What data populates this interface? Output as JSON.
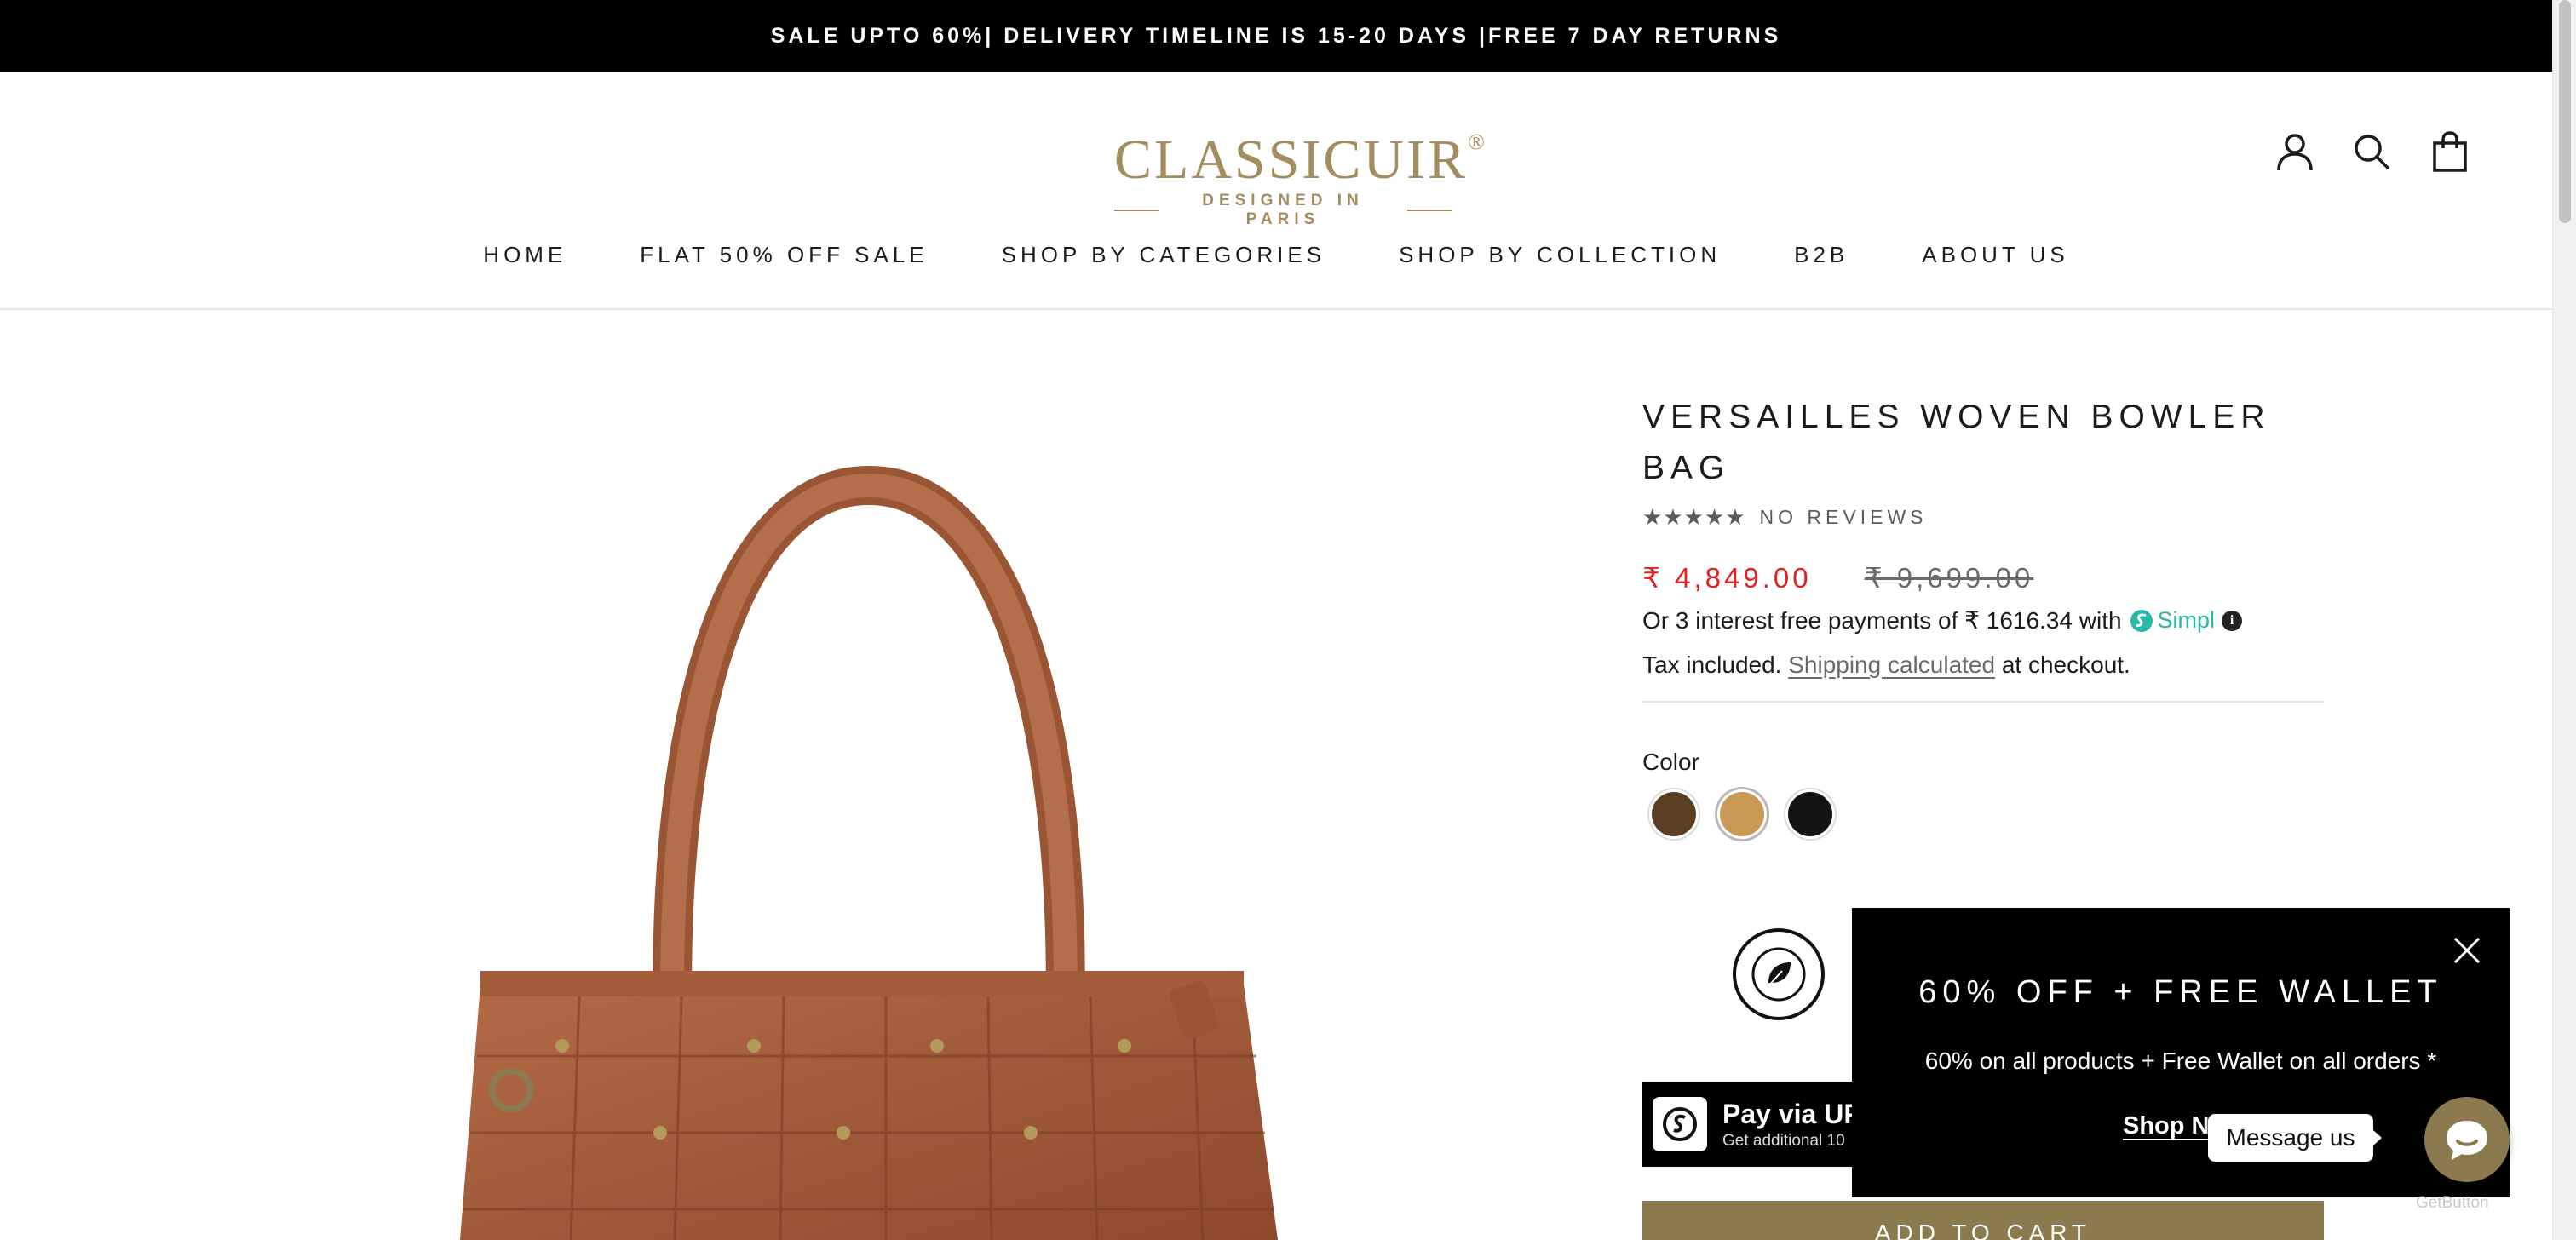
{
  "announcement": "SALE UPTO 60%| DELIVERY TIMELINE IS 15-20 DAYS |FREE 7 DAY RETURNS",
  "logo": {
    "brand": "CLASSICUIR",
    "registered": "®",
    "tagline": "DESIGNED IN PARIS"
  },
  "header_icons": [
    "account-icon",
    "search-icon",
    "cart-icon"
  ],
  "nav": [
    "HOME",
    "FLAT 50% OFF SALE",
    "SHOP BY CATEGORIES",
    "SHOP BY COLLECTION",
    "B2B",
    "ABOUT US"
  ],
  "product": {
    "title": "VERSAILLES WOVEN BOWLER BAG",
    "stars": "★★★★★",
    "reviews": "NO REVIEWS",
    "price_sale": "₹ 4,849.00",
    "price_original": "₹ 9,699.00",
    "simpl_text": "Or 3 interest free payments of ₹ 1616.34 with",
    "simpl_brand": "Simpl",
    "tax_prefix": "Tax included.",
    "tax_link": "Shipping calculated",
    "tax_suffix": "at checkout.",
    "color_label": "Color",
    "swatches": [
      "#5b3f24",
      "#c99a56",
      "#141414"
    ],
    "selected_swatch": 1
  },
  "upi": {
    "title": "Pay via UP",
    "subtitle": "Get additional 10"
  },
  "add_to_cart": "ADD TO CART",
  "popup": {
    "heading": "60% OFF + FREE WALLET",
    "text": "60% on all products + Free Wallet on all orders *",
    "link": "Shop No"
  },
  "chat": {
    "bubble": "Message us",
    "credit": "GetButton"
  },
  "colors": {
    "brand_gold": "#a38c5e",
    "sale_red": "#e22120",
    "button_olive": "#8a7a4e"
  }
}
